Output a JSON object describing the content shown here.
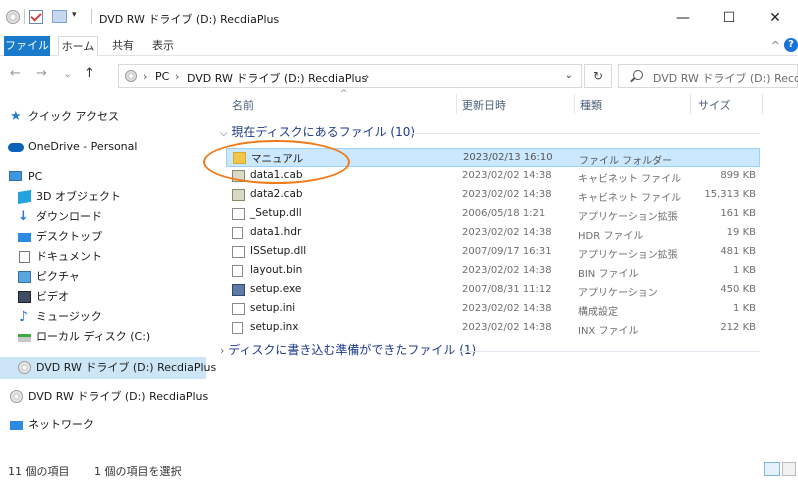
{
  "window": {
    "title": "DVD RW ドライブ (D:) RecdiaPlus",
    "quick_access_arrow": "▾",
    "minimize": "—",
    "maximize": "☐",
    "close": "✕"
  },
  "ribbon": {
    "tabs": [
      "ファイル",
      "ホーム",
      "共有",
      "表示"
    ],
    "collapse": "^",
    "help": "?"
  },
  "address": {
    "back": "←",
    "forward": "→",
    "recent": "⌄",
    "up": "↑",
    "segments": [
      "PC",
      "DVD RW ドライブ (D:) RecdiaPlus"
    ],
    "separator": "›",
    "dropdown": "⌄",
    "refresh": "↻"
  },
  "search": {
    "placeholder": "DVD RW ドライブ (D:) RecdiaPl..."
  },
  "sidebar": {
    "items": [
      {
        "label": "クイック アクセス",
        "icon": "quick-access-star-icon"
      },
      {
        "label": "OneDrive - Personal",
        "icon": "onedrive-cloud-icon"
      },
      {
        "label": "PC",
        "icon": "pc-icon"
      },
      {
        "label": "3D オブジェクト",
        "icon": "3d-objects-icon"
      },
      {
        "label": "ダウンロード",
        "icon": "downloads-icon"
      },
      {
        "label": "デスクトップ",
        "icon": "desktop-icon"
      },
      {
        "label": "ドキュメント",
        "icon": "documents-icon"
      },
      {
        "label": "ピクチャ",
        "icon": "pictures-icon"
      },
      {
        "label": "ビデオ",
        "icon": "videos-icon"
      },
      {
        "label": "ミュージック",
        "icon": "music-icon"
      },
      {
        "label": "ローカル ディスク (C:)",
        "icon": "local-disk-icon"
      },
      {
        "label": "DVD RW ドライブ (D:) RecdiaPlus",
        "icon": "dvd-drive-icon"
      },
      {
        "label": "DVD RW ドライブ (D:) RecdiaPlus",
        "icon": "dvd-drive-icon"
      },
      {
        "label": "ネットワーク",
        "icon": "network-icon"
      }
    ]
  },
  "columns": {
    "name": "名前",
    "date": "更新日時",
    "type": "種類",
    "size": "サイズ",
    "sort_indicator": "^"
  },
  "groups": {
    "current": {
      "chevron": "⌵",
      "label": "現在ディスクにあるファイル (10)"
    },
    "pending": {
      "chevron": "›",
      "label": "ディスクに書き込む準備ができたファイル (1)"
    }
  },
  "files": [
    {
      "name": "マニュアル",
      "date": "2023/02/13 16:10",
      "type": "ファイル フォルダー",
      "size": "",
      "icon": "folder-icon"
    },
    {
      "name": "data1.cab",
      "date": "2023/02/02 14:38",
      "type": "キャビネット ファイル",
      "size": "899 KB",
      "icon": "cab-file-icon"
    },
    {
      "name": "data2.cab",
      "date": "2023/02/02 14:38",
      "type": "キャビネット ファイル",
      "size": "15,313 KB",
      "icon": "cab-file-icon"
    },
    {
      "name": "_Setup.dll",
      "date": "2006/05/18 1:21",
      "type": "アプリケーション拡張",
      "size": "161 KB",
      "icon": "dll-file-icon"
    },
    {
      "name": "data1.hdr",
      "date": "2023/02/02 14:38",
      "type": "HDR ファイル",
      "size": "19 KB",
      "icon": "generic-file-icon"
    },
    {
      "name": "ISSetup.dll",
      "date": "2007/09/17 16:31",
      "type": "アプリケーション拡張",
      "size": "481 KB",
      "icon": "dll-file-icon"
    },
    {
      "name": "layout.bin",
      "date": "2023/02/02 14:38",
      "type": "BIN ファイル",
      "size": "1 KB",
      "icon": "generic-file-icon"
    },
    {
      "name": "setup.exe",
      "date": "2007/08/31 11:12",
      "type": "アプリケーション",
      "size": "450 KB",
      "icon": "exe-file-icon"
    },
    {
      "name": "setup.ini",
      "date": "2023/02/02 14:38",
      "type": "構成設定",
      "size": "1 KB",
      "icon": "ini-file-icon"
    },
    {
      "name": "setup.inx",
      "date": "2023/02/02 14:38",
      "type": "INX ファイル",
      "size": "212 KB",
      "icon": "generic-file-icon"
    }
  ],
  "status": {
    "count": "11 個の項目",
    "selected": "1 個の項目を選択"
  },
  "colors": {
    "accent": "#1979ca",
    "selection": "#cce8ff",
    "annotation": "#f07a19"
  }
}
